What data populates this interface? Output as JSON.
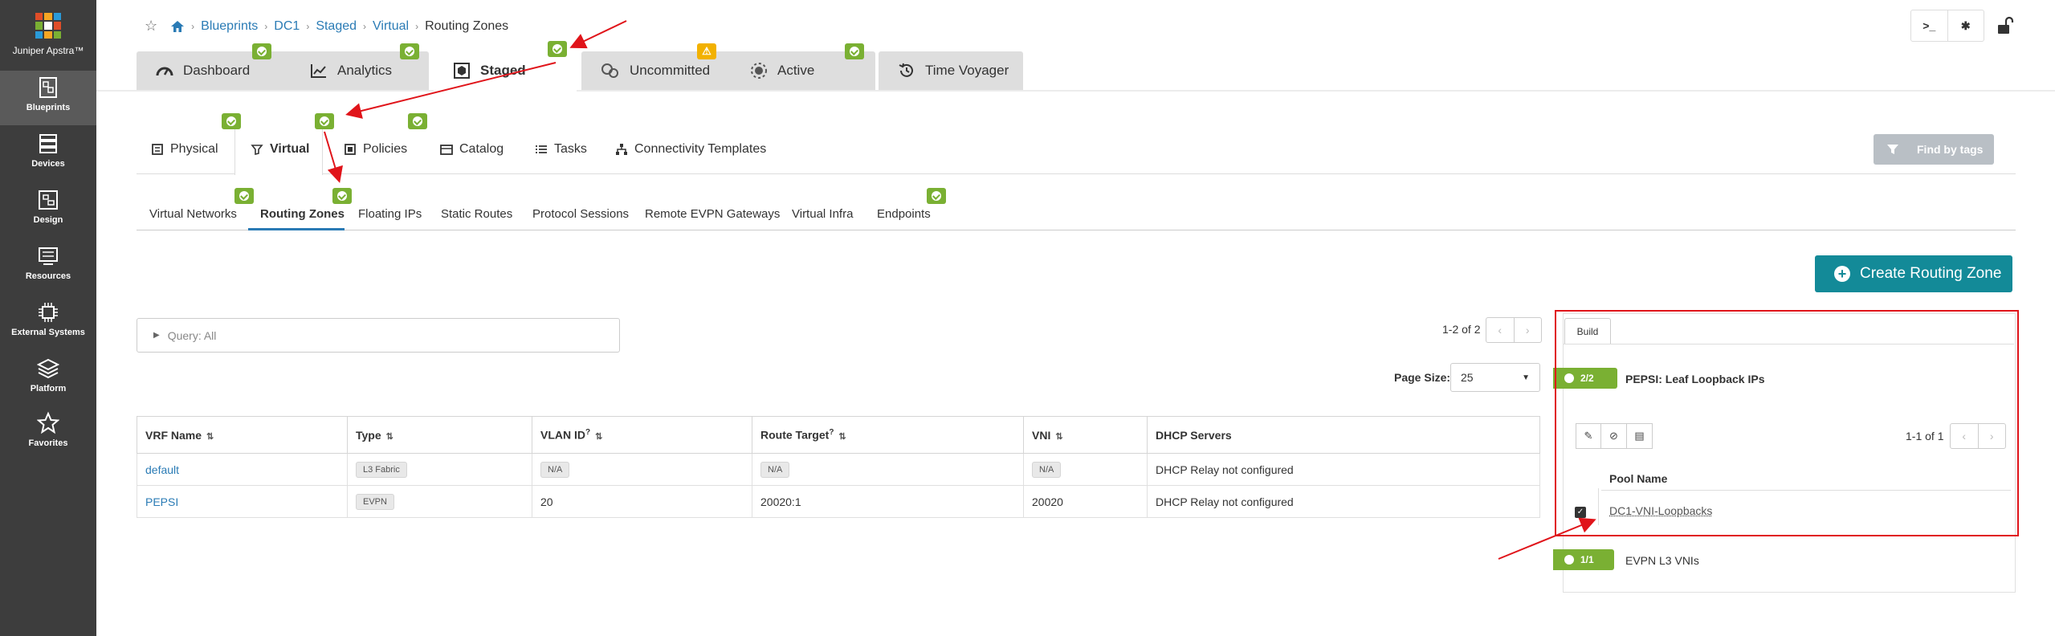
{
  "sidebar": {
    "brand": "Juniper Apstra™",
    "items": [
      {
        "label": "Blueprints",
        "icon": "blueprints-icon",
        "active": true
      },
      {
        "label": "Devices",
        "icon": "devices-icon",
        "active": false
      },
      {
        "label": "Design",
        "icon": "design-icon",
        "active": false
      },
      {
        "label": "Resources",
        "icon": "resources-icon",
        "active": false
      },
      {
        "label": "External Systems",
        "icon": "external-systems-icon",
        "active": false
      },
      {
        "label": "Platform",
        "icon": "platform-icon",
        "active": false
      },
      {
        "label": "Favorites",
        "icon": "star-icon",
        "active": false
      }
    ]
  },
  "breadcrumb": [
    "Blueprints",
    "DC1",
    "Staged",
    "Virtual"
  ],
  "breadcrumb_current": "Routing Zones",
  "top_tabs": [
    {
      "label": "Dashboard",
      "icon": "speedometer-icon",
      "badge": "ok"
    },
    {
      "label": "Analytics",
      "icon": "chart-line-icon",
      "badge": "ok"
    },
    {
      "label": "Staged",
      "icon": "staged-icon",
      "badge": "ok",
      "active": true
    },
    {
      "label": "Uncommitted",
      "icon": "uncommitted-icon",
      "badge": "warn"
    },
    {
      "label": "Active",
      "icon": "active-icon",
      "badge": "ok"
    },
    {
      "label": "Time Voyager",
      "icon": "history-icon"
    }
  ],
  "sub_tabs": [
    "Physical",
    "Virtual",
    "Policies",
    "Catalog",
    "Tasks",
    "Connectivity Templates"
  ],
  "sub_tab_active": "Virtual",
  "find_by_tags": "Find by tags",
  "virtual_tabs": [
    "Virtual Networks",
    "Routing Zones",
    "Floating IPs",
    "Static Routes",
    "Protocol Sessions",
    "Remote EVPN Gateways",
    "Virtual Infra",
    "Endpoints"
  ],
  "virtual_tab_active": "Routing Zones",
  "create_button": "Create Routing Zone",
  "query": "Query: All",
  "pager": {
    "text": "1-2 of 2",
    "page_size_label": "Page Size:",
    "page_size": "25"
  },
  "table": {
    "headers": [
      "VRF Name",
      "Type",
      "VLAN ID",
      "Route Target",
      "VNI",
      "DHCP Servers"
    ],
    "rows": [
      {
        "vrf": "default",
        "type": "L3 Fabric",
        "vlan": "N/A",
        "rt": "N/A",
        "vni": "N/A",
        "dhcp": "DHCP Relay not configured"
      },
      {
        "vrf": "PEPSI",
        "type": "EVPN",
        "vlan": "20",
        "rt": "20020:1",
        "vni": "20020",
        "dhcp": "DHCP Relay not configured"
      }
    ]
  },
  "panel": {
    "tab": "Build",
    "group1": {
      "badge": "2/2",
      "title": "PEPSI: Leaf Loopback IPs"
    },
    "pager": "1-1 of 1",
    "col": "Pool Name",
    "pool": "DC1-VNI-Loopbacks",
    "group2": {
      "badge": "1/1",
      "title": "EVPN L3 VNIs"
    }
  },
  "colors": {
    "sidebar": "#3d3d3d",
    "accent": "#138a98",
    "link": "#2a7bb5",
    "ok": "#7ab033",
    "warn": "#f2b100",
    "annotation": "#e0141a"
  }
}
